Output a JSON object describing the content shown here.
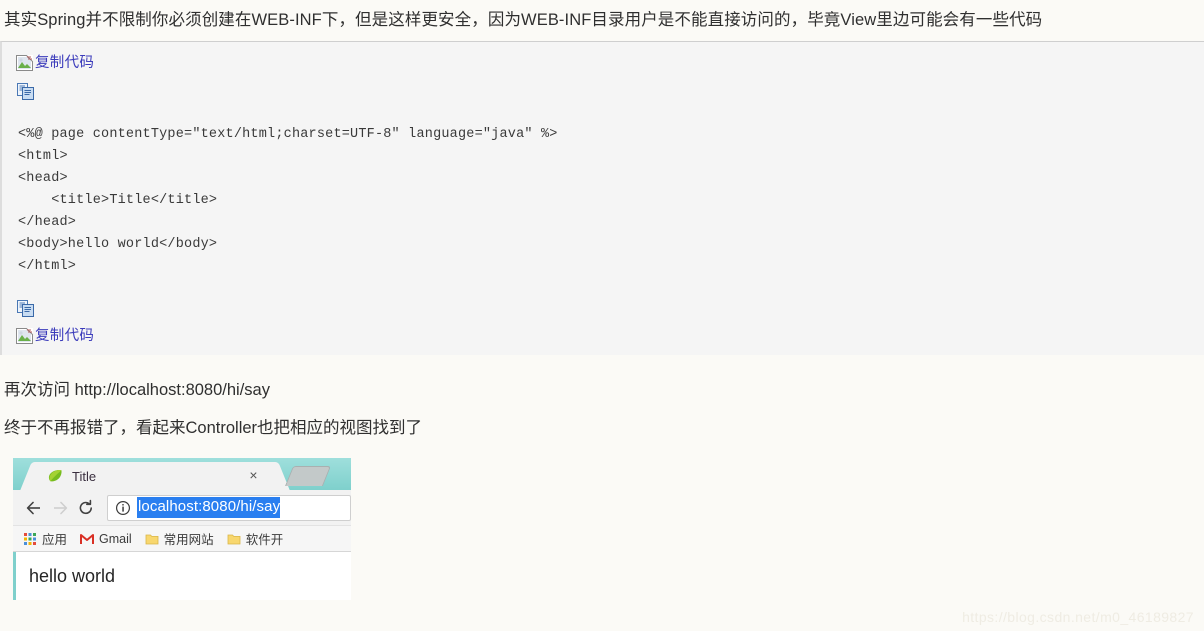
{
  "page": {
    "intro_text": "其实Spring并不限制你必须创建在WEB-INF下，但是这样更安全，因为WEB-INF目录用户是不能直接访问的，毕竟View里边可能会有一些代码",
    "visit_text": "再次访问 http://localhost:8080/hi/say",
    "result_text": "终于不再报错了，看起来Controller也把相应的视图找到了",
    "watermark": "https://blog.csdn.net/m0_46189827"
  },
  "code_block": {
    "copy_label_top": "复制代码",
    "copy_label_bottom": "复制代码",
    "copy_icon_name": "copy-icon",
    "broken_image_icon_name": "broken-image-icon",
    "code": "<%@ page contentType=\"text/html;charset=UTF-8\" language=\"java\" %>\n<html>\n<head>\n    <title>Title</title>\n</head>\n<body>hello world</body>\n</html>"
  },
  "browser": {
    "tab": {
      "title": "Title",
      "favicon_name": "spring-leaf-favicon",
      "close_label": "×"
    },
    "newtab_label": "",
    "toolbar": {
      "back_label": "←",
      "forward_label": "→",
      "reload_label": "⟳",
      "url": "localhost:8080/hi/say",
      "security_icon_name": "info-circle-icon"
    },
    "bookmarks": [
      {
        "label": "应用",
        "icon": "apps-grid-icon"
      },
      {
        "label": "Gmail",
        "icon": "gmail-icon"
      },
      {
        "label": "常用网站",
        "icon": "folder-icon"
      },
      {
        "label": "软件开",
        "icon": "folder-icon"
      }
    ],
    "page_content": "hello world"
  },
  "colors": {
    "page_bg": "#fbfaf6",
    "code_bg": "#f5f5f5",
    "link_blue": "#3b3bbb",
    "tabstrip_teal": "#7fd0cc",
    "selection_blue": "#2a7ff0"
  }
}
